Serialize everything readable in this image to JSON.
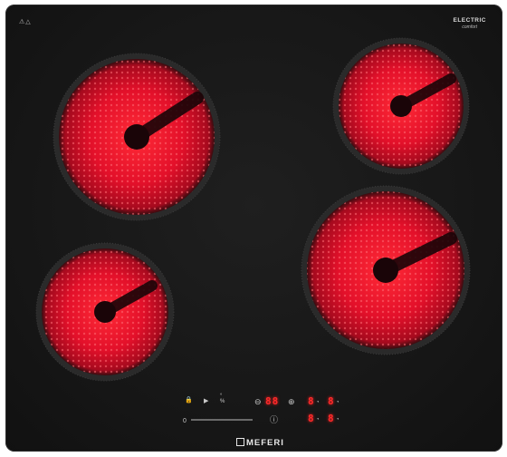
{
  "brand": {
    "line1": "ELECTRIC",
    "line2": "comfort"
  },
  "logo": {
    "text": "MEFERI"
  },
  "top_left_symbols": "⚠△",
  "zones": [
    {
      "id": "zone-front-left-large-top",
      "label": "rear-left zone"
    },
    {
      "id": "zone-rear-right",
      "label": "rear-right zone"
    },
    {
      "id": "zone-front-left",
      "label": "front-left zone"
    },
    {
      "id": "zone-front-right",
      "label": "front-right zone"
    }
  ],
  "controls": {
    "timer_display": "88",
    "zone_display_1": "8",
    "zone_display_2": "8",
    "zone_display_3": "8",
    "zone_display_4": "8",
    "minus": "⊖",
    "plus": "⊕",
    "lock": "🔒",
    "play": "▶",
    "slider_zero": "0",
    "info": "ⓘ"
  },
  "colors": {
    "glass": "#171717",
    "heat": "#e0102a",
    "led": "#ff2a2a"
  }
}
